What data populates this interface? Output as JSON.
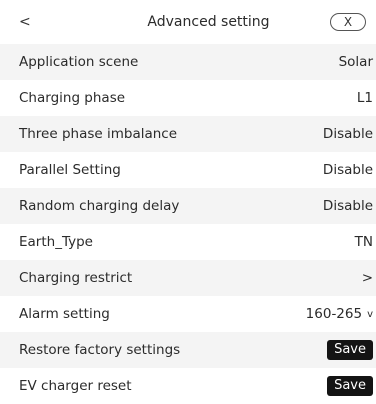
{
  "header": {
    "back_label": "<",
    "title": "Advanced setting",
    "close_label": "X"
  },
  "rows": [
    {
      "label": "Application scene",
      "value": "Solar"
    },
    {
      "label": "Charging phase",
      "value": "L1"
    },
    {
      "label": "Three phase imbalance",
      "value": "Disable"
    },
    {
      "label": "Parallel Setting",
      "value": "Disable"
    },
    {
      "label": "Random charging delay",
      "value": "Disable"
    },
    {
      "label": "Earth_Type",
      "value": "TN"
    },
    {
      "label": "Charging restrict",
      "value": ">"
    },
    {
      "label": "Alarm setting",
      "value": "160-265",
      "chevron": "v"
    },
    {
      "label": "Restore factory settings",
      "button": "Save"
    },
    {
      "label": "EV charger reset",
      "button": "Save"
    }
  ]
}
